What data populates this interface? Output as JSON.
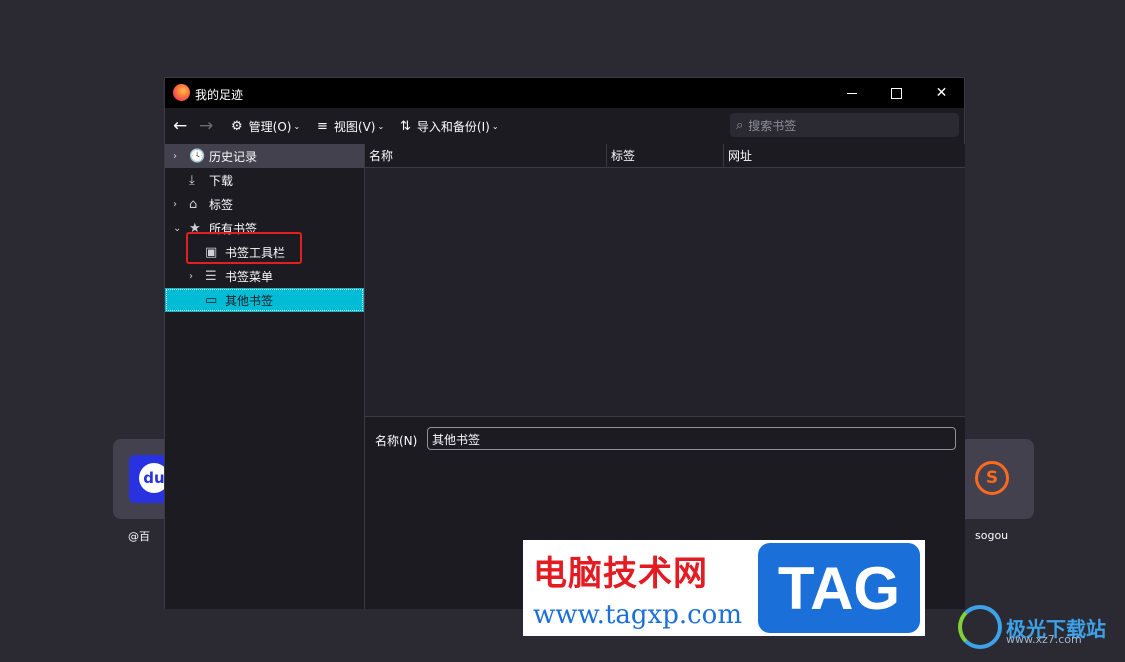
{
  "background": {
    "tiles": [
      {
        "caption": "@百",
        "logo_text": "du"
      },
      {
        "caption": "sogou",
        "logo_text": "S"
      }
    ]
  },
  "window": {
    "title": "我的足迹",
    "controls": {
      "minimize": "minimize-icon",
      "maximize": "maximize-icon",
      "close": "✕"
    }
  },
  "toolbar": {
    "back": "←",
    "forward": "→",
    "manage": {
      "label": "管理(O)",
      "icon": "⚙"
    },
    "view": {
      "label": "视图(V)",
      "icon": "≡"
    },
    "import": {
      "label": "导入和备份(I)",
      "icon": "⇅"
    },
    "caret": "⌄",
    "search": {
      "placeholder": "搜索书签",
      "icon": "⌕"
    }
  },
  "tree": {
    "items": [
      {
        "label": "历史记录",
        "icon": "🕓",
        "twisty": "›"
      },
      {
        "label": "下载",
        "icon": "⤓"
      },
      {
        "label": "标签",
        "icon": "⌂",
        "twisty": "›"
      },
      {
        "label": "所有书签",
        "icon": "★",
        "twisty": "⌄"
      },
      {
        "label": "书签工具栏",
        "icon": "▣"
      },
      {
        "label": "书签菜单",
        "icon": "☰",
        "twisty": "›"
      },
      {
        "label": "其他书签",
        "icon": "▭"
      }
    ],
    "selected": "其他书签"
  },
  "list": {
    "columns": [
      "名称",
      "标签",
      "网址"
    ],
    "rows": []
  },
  "details": {
    "name_label": "名称(N)",
    "name_value": "其他书签"
  },
  "watermark": {
    "cn_text": "电脑技术网",
    "url": "www.tagxp.com",
    "tag": "TAG",
    "site_name": "极光下载站",
    "site_url": "www.xz7.com"
  },
  "colors": {
    "background": "#2b2a33",
    "selection": "#00bcd4",
    "highlight_box": "#e02020"
  }
}
